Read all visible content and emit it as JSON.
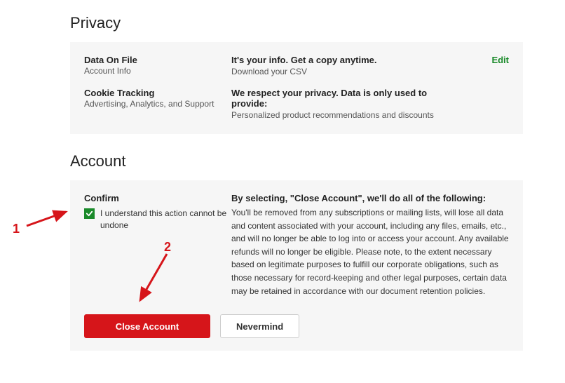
{
  "privacy": {
    "heading": "Privacy",
    "data_on_file": {
      "title": "Data On File",
      "sub": "Account Info",
      "head": "It's your info. Get a copy anytime.",
      "desc": "Download your CSV",
      "edit": "Edit"
    },
    "cookie": {
      "title": "Cookie Tracking",
      "sub": "Advertising, Analytics, and Support",
      "head": "We respect your privacy. Data is only used to provide:",
      "desc": "Personalized product recommendations and discounts"
    }
  },
  "account": {
    "heading": "Account",
    "confirm_title": "Confirm",
    "confirm_text": "I understand this action cannot be undone",
    "close_head": "By selecting, \"Close Account\", we'll do all of the following:",
    "close_body": "You'll be removed from any subscriptions or mailing lists, will lose all data and content associated with your account, including any files, emails, etc., and will no longer be able to log into or access your account. Any available refunds will no longer be eligible. Please note, to the extent necessary based on legitimate purposes to fulfill our corporate obligations, such as those necessary for record-keeping and other legal purposes, certain data may be retained in accordance with our document retention policies.",
    "close_btn": "Close Account",
    "nevermind_btn": "Nevermind"
  },
  "annotations": {
    "one": "1",
    "two": "2"
  }
}
